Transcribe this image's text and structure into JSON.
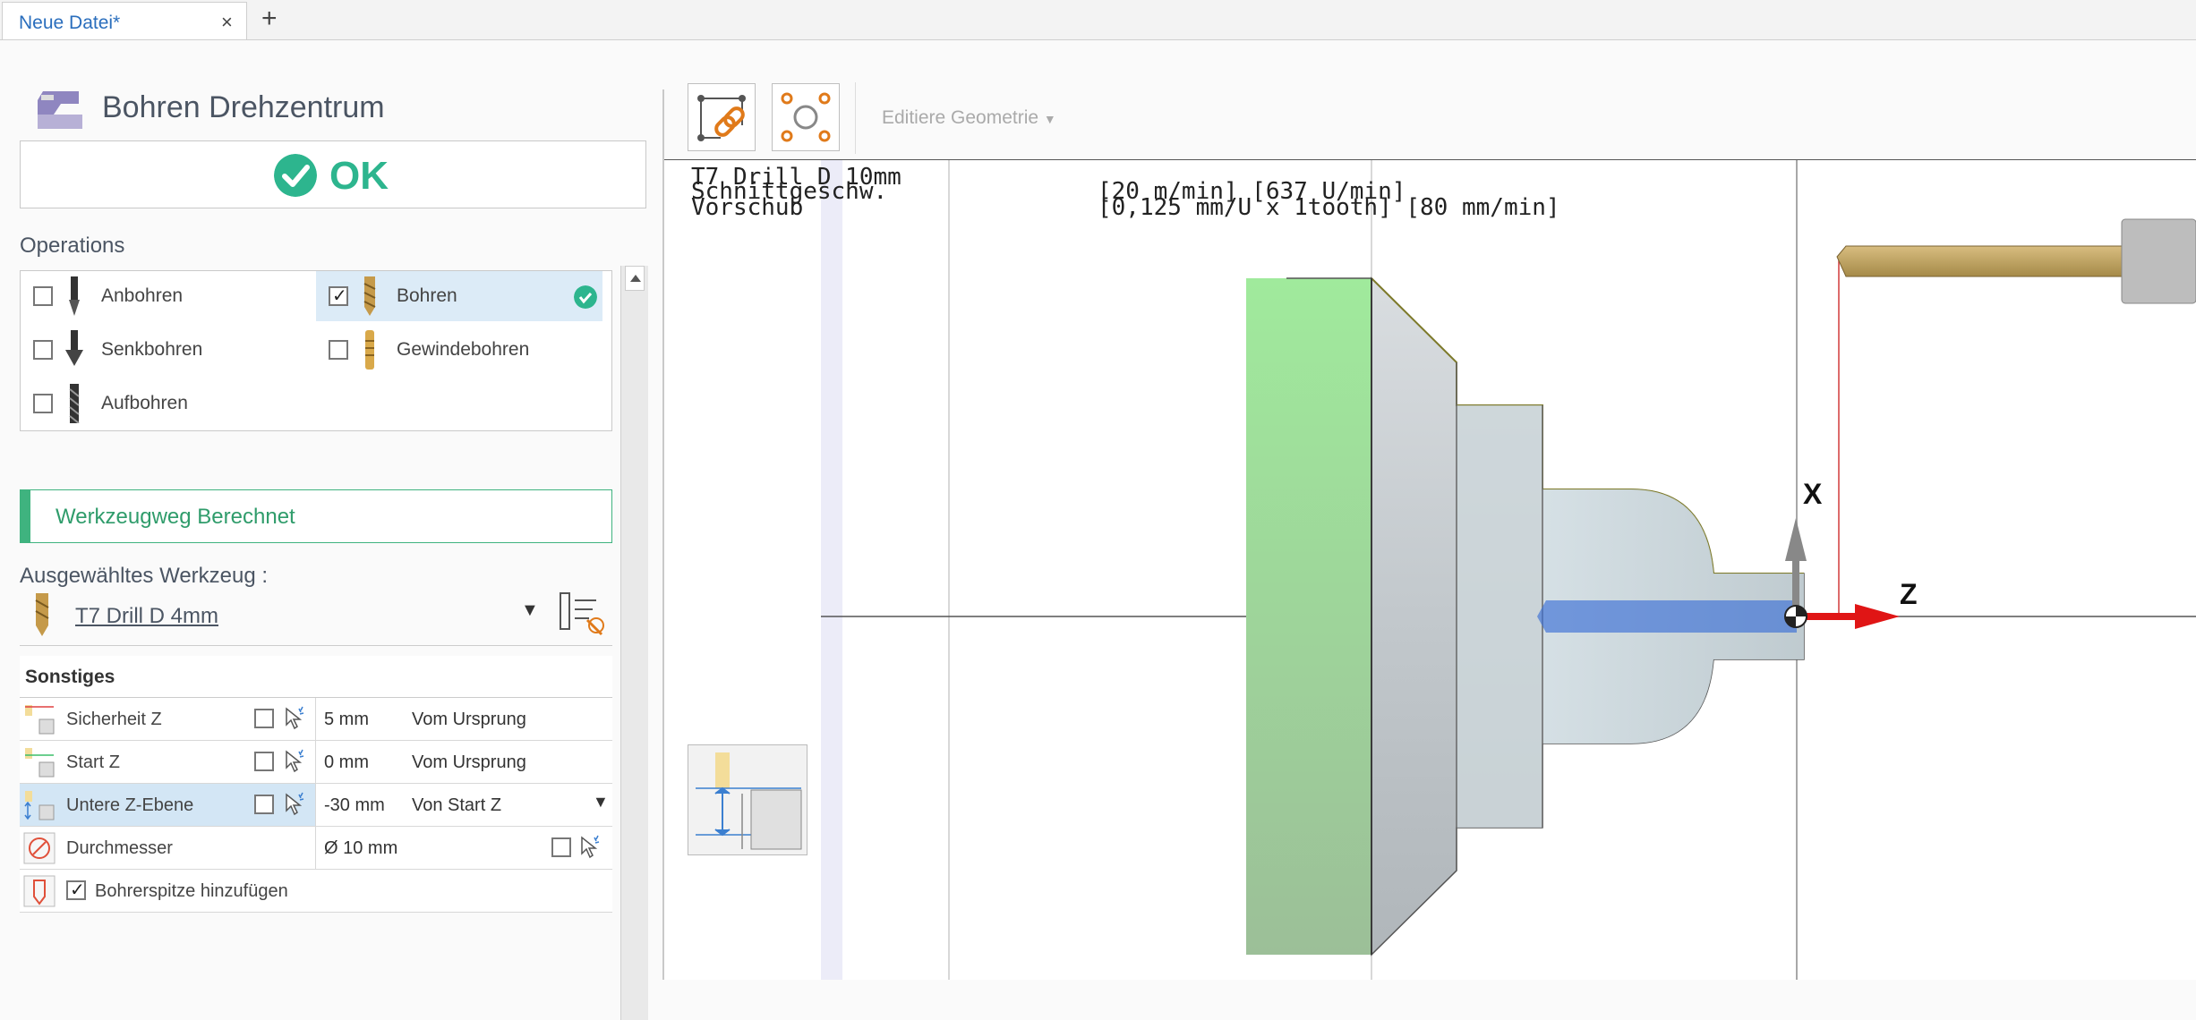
{
  "tabs": {
    "active_title": "Neue Datei*",
    "close_icon": "×",
    "add_icon": "+"
  },
  "operation": {
    "title": "Bohren Drehzentrum",
    "ok_label": "OK"
  },
  "operations": {
    "label": "Operations",
    "items": [
      {
        "label": "Anbohren",
        "checked": false
      },
      {
        "label": "Bohren",
        "checked": true
      },
      {
        "label": "Senkbohren",
        "checked": false
      },
      {
        "label": "Gewindebohren",
        "checked": false
      },
      {
        "label": "Aufbohren",
        "checked": false
      }
    ]
  },
  "status": {
    "text": "Werkzeugweg Berechnet",
    "color": "#3fb37f"
  },
  "tool": {
    "label": "Ausgewähltes Werkzeug",
    "colon": ":",
    "name": "T7 Drill D 4mm"
  },
  "properties": {
    "section": "Sonstiges",
    "rows": [
      {
        "name": "Sicherheit Z",
        "value": "5 mm",
        "reference": "Vom Ursprung"
      },
      {
        "name": "Start Z",
        "value": "0 mm",
        "reference": "Vom Ursprung"
      },
      {
        "name": "Untere Z-Ebene",
        "value": "-30 mm",
        "reference": "Von Start Z"
      },
      {
        "name": "Durchmesser",
        "value": "Ø 10 mm"
      },
      {
        "name": "Bohrerspitze hinzufügen",
        "checked": true
      }
    ]
  },
  "viewport": {
    "edit_geometry": "Editiere Geometrie",
    "info": {
      "line1": "T7 Drill D 10mm",
      "line2_label": "Schnittgeschw.",
      "line2_value": "[20 m/min] [637 U/min]",
      "line3_label": "Vorschub",
      "line3_value": "[0,125 mm/U x 1tooth] [80 mm/min]"
    },
    "axis_x": "X",
    "axis_z": "Z"
  },
  "colors": {
    "accent": "#2db58e",
    "stock": "#9de69a",
    "part": "#bfc5c9",
    "tool_gold": "#c7a767",
    "axis_red": "#e01515"
  }
}
